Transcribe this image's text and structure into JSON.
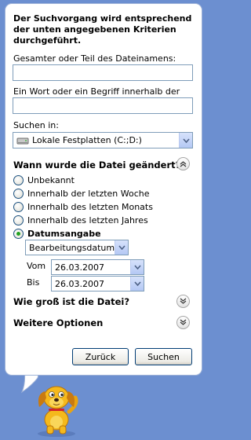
{
  "intro": "Der Suchvorgang wird entsprechend der unten angegebenen Kriterien durchgeführt.",
  "filename": {
    "label": "Gesamter oder Teil des Dateinamens:",
    "value": ""
  },
  "word": {
    "label": "Ein Wort oder ein Begriff innerhalb der Datei:",
    "value": ""
  },
  "search_in": {
    "label": "Suchen in:",
    "selected": "Lokale Festplatten (C:;D:)",
    "icon": "hard-drive-icon"
  },
  "date_section": {
    "title": "Wann wurde die Datei geändert?",
    "options": [
      {
        "label": "Unbekannt",
        "checked": false
      },
      {
        "label": "Innerhalb der letzten Woche",
        "checked": false
      },
      {
        "label": "Innerhalb des letzten Monats",
        "checked": false
      },
      {
        "label": "Innerhalb des letzten Jahres",
        "checked": false
      },
      {
        "label": "Datumsangabe",
        "checked": true
      }
    ],
    "date_type": "Bearbeitungsdatum",
    "from_label": "Vom",
    "from_value": "26.03.2007",
    "to_label": "Bis",
    "to_value": "26.03.2007"
  },
  "size_section": {
    "title": "Wie groß ist die Datei?"
  },
  "more_section": {
    "title": "Weitere Optionen"
  },
  "buttons": {
    "back": "Zurück",
    "search": "Suchen"
  },
  "colors": {
    "background": "#6c8fd0",
    "panel": "#ffffff",
    "accent_border": "#7f9db9",
    "radio_selected": "#21a121"
  }
}
